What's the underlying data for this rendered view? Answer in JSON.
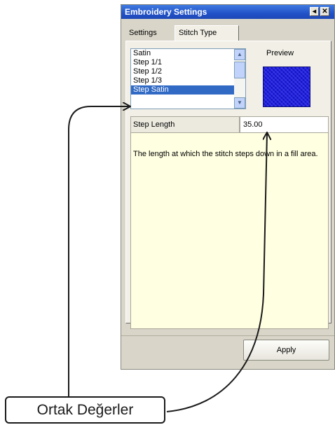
{
  "window": {
    "title": "Embroidery Settings",
    "buttons": {
      "pin_glyph": "◂",
      "close_glyph": "✕"
    }
  },
  "tabs": [
    {
      "label": "Settings",
      "active": false
    },
    {
      "label": "Stitch Type",
      "active": true
    }
  ],
  "stitch_list": {
    "items": [
      "Satin",
      "Step 1/1",
      "Step 1/2",
      "Step 1/3",
      "Step Satin"
    ],
    "selected": "Step Satin"
  },
  "preview": {
    "label": "Preview"
  },
  "property": {
    "name": "Step Length",
    "value": "35.00"
  },
  "description": "The length at which the stitch steps down in a fill area.",
  "apply_label": "Apply",
  "callout": {
    "label": "Ortak Değerler"
  },
  "colors": {
    "title_bar": "#2252c8",
    "selection": "#316ac5",
    "description_bg": "#ffffe1",
    "preview_fill": "#2020d8"
  }
}
